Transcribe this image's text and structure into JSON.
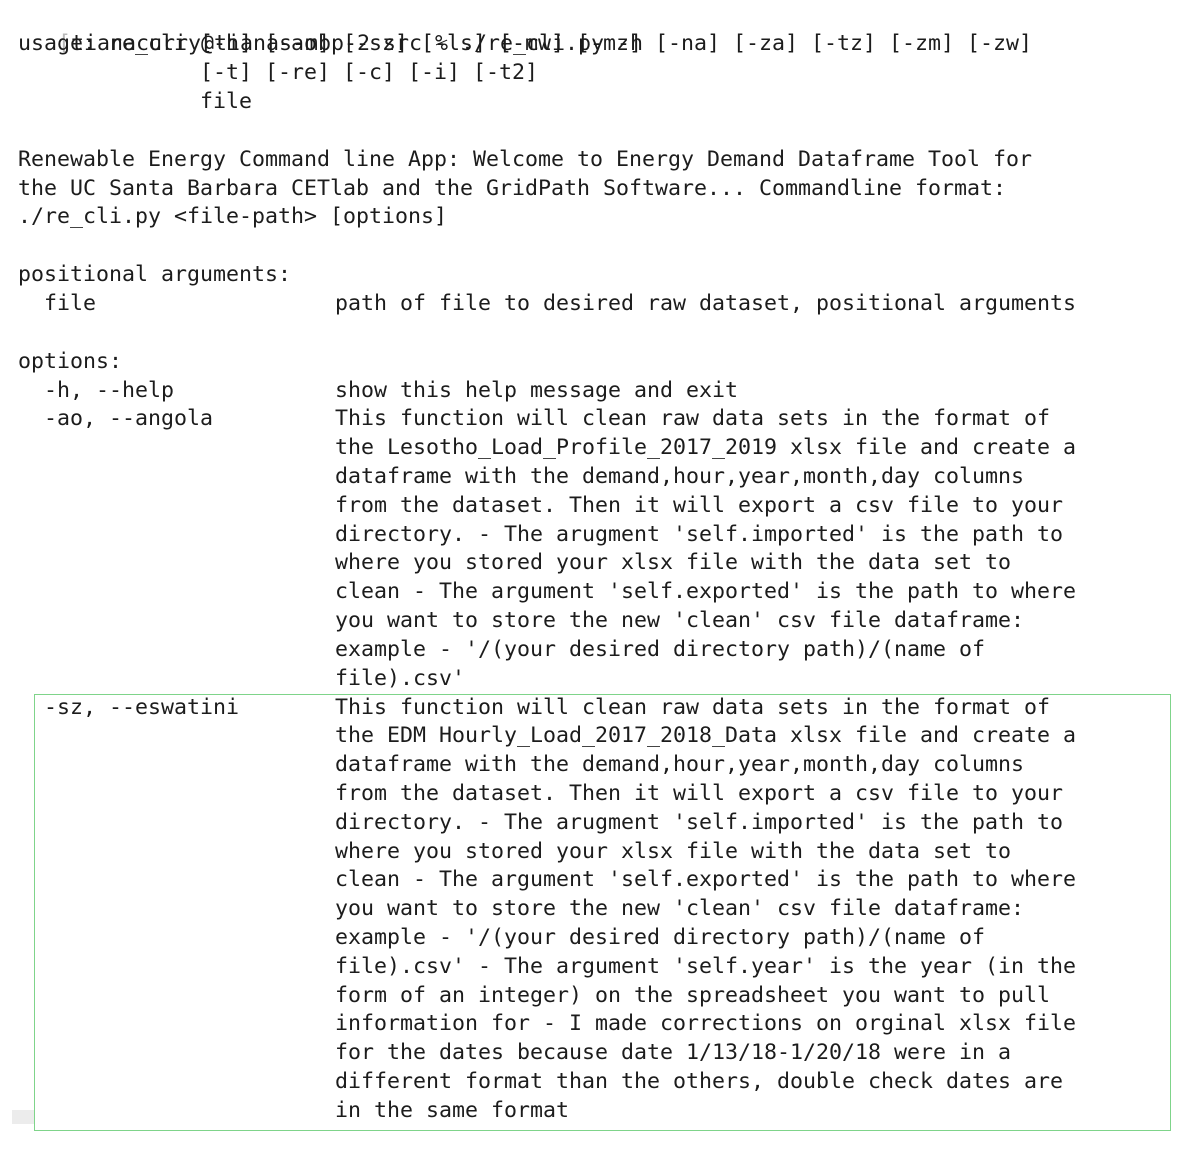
{
  "terminal": {
    "prompt_bracket": "[",
    "prompt": "tianacurry@tianas-mbp-2 src % ./re_cli.py -h",
    "usage": [
      "usage: re_cli [-h] [-ao] [-sz] [-ls] [-mw] [-mz] [-na] [-za] [-tz] [-zm] [-zw]",
      "              [-t] [-re] [-c] [-i] [-t2]",
      "              file"
    ],
    "description": [
      "Renewable Energy Command line App: Welcome to Energy Demand Dataframe Tool for",
      "the UC Santa Barbara CETlab and the GridPath Software... Commandline format:",
      "./re_cli.py <file-path> [options]"
    ],
    "positional_header": "positional arguments:",
    "positional_file_name": "  file",
    "positional_file_desc": "path of file to desired raw dataset, positional arguments",
    "options_header": "options:",
    "help_flag": "  -h, --help",
    "help_desc": "show this help message and exit",
    "angola_flag": "  -ao, --angola",
    "angola_desc": [
      "This function will clean raw data sets in the format of",
      "the Lesotho_Load_Profile_2017_2019 xlsx file and create a",
      "dataframe with the demand,hour,year,month,day columns",
      "from the dataset. Then it will export a csv file to your",
      "directory. - The arugment 'self.imported' is the path to",
      "where you stored your xlsx file with the data set to",
      "clean - The argument 'self.exported' is the path to where",
      "you want to store the new 'clean' csv file dataframe:",
      "example - '/(your desired directory path)/(name of",
      "file).csv'"
    ],
    "eswatini_flag": "  -sz, --eswatini",
    "eswatini_desc": [
      "This function will clean raw data sets in the format of",
      "the EDM Hourly_Load_2017_2018_Data xlsx file and create a",
      "dataframe with the demand,hour,year,month,day columns",
      "from the dataset. Then it will export a csv file to your",
      "directory. - The arugment 'self.imported' is the path to",
      "where you stored your xlsx file with the data set to",
      "clean - The argument 'self.exported' is the path to where",
      "you want to store the new 'clean' csv file dataframe:",
      "example - '/(your desired directory path)/(name of",
      "file).csv' - The argument 'self.year' is the year (in the",
      "form of an integer) on the spreadsheet you want to pull",
      "information for - I made corrections on orginal xlsx file",
      "for the dates because date 1/13/18-1/20/18 were in a",
      "different format than the others, double check dates are",
      "in the same format"
    ]
  },
  "colors": {
    "background": "#ffffff",
    "text": "#1c1c1c",
    "highlight_border": "#7fd48a"
  }
}
